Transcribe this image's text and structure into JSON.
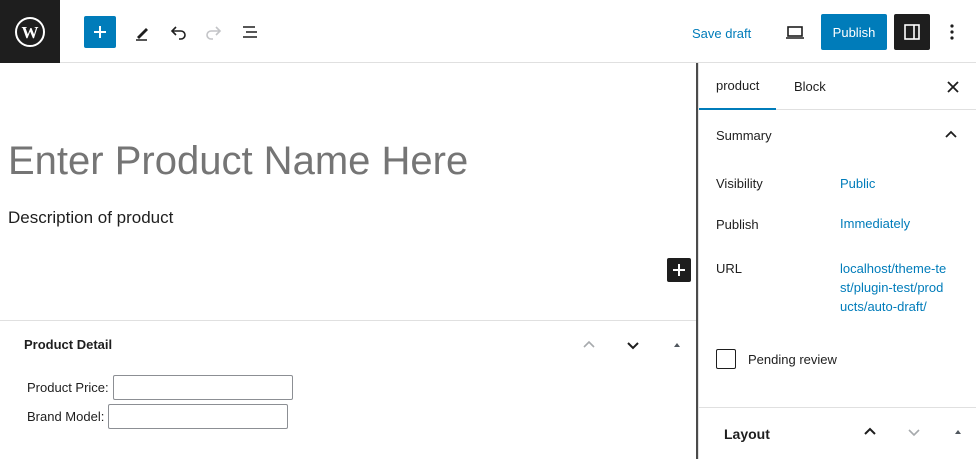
{
  "toolbar": {
    "save_draft": "Save draft",
    "publish": "Publish"
  },
  "editor": {
    "title_placeholder": "Enter Product Name Here",
    "description": "Description of product"
  },
  "meta_box": {
    "title": "Product Detail",
    "fields": [
      {
        "label": "Product Price:",
        "value": ""
      },
      {
        "label": "Brand Model:",
        "value": ""
      }
    ]
  },
  "sidebar": {
    "tabs": [
      "product",
      "Block"
    ],
    "summary": {
      "title": "Summary",
      "visibility_label": "Visibility",
      "visibility_value": "Public",
      "publish_label": "Publish",
      "publish_value": "Immediately",
      "url_label": "URL",
      "url_value": "localhost/theme-test/plugin-test/products/auto-draft/",
      "pending_review": "Pending review"
    },
    "layout_title": "Layout"
  },
  "colors": {
    "accent": "#007cba",
    "dark": "#1e1e1e"
  }
}
